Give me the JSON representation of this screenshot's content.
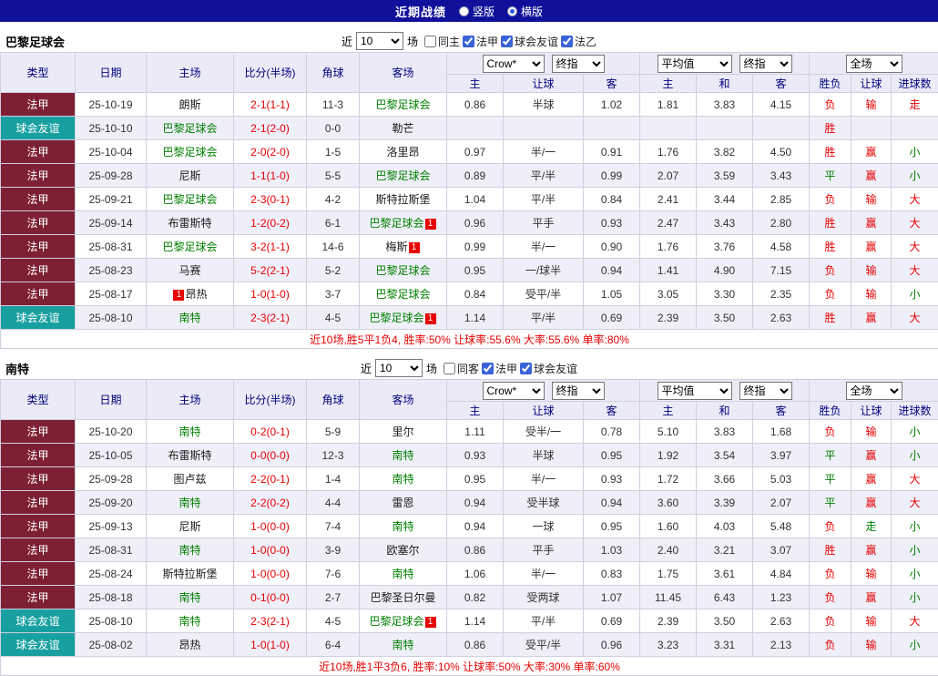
{
  "titlebar": {
    "title": "近期战绩",
    "radios": [
      {
        "label": "竖版",
        "selected": false
      },
      {
        "label": "横版",
        "selected": true
      }
    ]
  },
  "columns": {
    "type": "类型",
    "date": "日期",
    "home": "主场",
    "score": "比分(半场)",
    "corner": "角球",
    "away": "客场",
    "asian": [
      "主",
      "让球",
      "客"
    ],
    "euro": [
      "主",
      "和",
      "客"
    ],
    "result": [
      "胜负",
      "让球",
      "进球数"
    ]
  },
  "controls": {
    "near_label": "近",
    "near_value": "10",
    "games_label": "场",
    "selects": {
      "book": "Crow*",
      "final": "终指",
      "avg": "平均值",
      "final2": "终指",
      "scope": "全场"
    }
  },
  "colors": {
    "titlebar_bg": "#10109b",
    "league_bg": "#7e2033",
    "friendly_bg": "#18a0a0",
    "header_bg": "#ebebf8",
    "header_text": "#00007d",
    "highlight_team_green": "#008000",
    "accent_red": "#e60000",
    "alt_row_bg": "#efeff9"
  },
  "sections": [
    {
      "team": "巴黎足球会",
      "filters": [
        {
          "label": "同主",
          "checked": false
        },
        {
          "label": "法甲",
          "checked": true
        },
        {
          "label": "球会友谊",
          "checked": true
        },
        {
          "label": "法乙",
          "checked": true
        }
      ],
      "summary": "近10场,胜5平1负4, 胜率:50% 让球率:55.6% 大率:55.6% 单率:80%",
      "rows": [
        {
          "type": "法甲",
          "date": "25-10-19",
          "home": "朗斯",
          "home_hl": false,
          "score": "2-1(1-1)",
          "corner": "11-3",
          "away": "巴黎足球会",
          "away_hl": true,
          "asian": [
            "0.86",
            "半球",
            "1.02"
          ],
          "euro": [
            "1.81",
            "3.83",
            "4.15"
          ],
          "result": [
            "负",
            "输",
            "走"
          ],
          "result_colors": [
            "red",
            "red",
            "red"
          ]
        },
        {
          "type": "球会友谊",
          "friendly": true,
          "date": "25-10-10",
          "home": "巴黎足球会",
          "home_hl": true,
          "score": "2-1(2-0)",
          "corner": "0-0",
          "away": "勒芒",
          "away_hl": false,
          "asian": [
            "",
            "",
            ""
          ],
          "euro": [
            "",
            "",
            ""
          ],
          "result": [
            "胜",
            "",
            ""
          ],
          "result_colors": [
            "red",
            "",
            ""
          ]
        },
        {
          "type": "法甲",
          "date": "25-10-04",
          "home": "巴黎足球会",
          "home_hl": true,
          "score": "2-0(2-0)",
          "corner": "1-5",
          "away": "洛里昂",
          "away_hl": false,
          "asian": [
            "0.97",
            "半/一",
            "0.91"
          ],
          "euro": [
            "1.76",
            "3.82",
            "4.50"
          ],
          "result": [
            "胜",
            "赢",
            "小"
          ],
          "result_colors": [
            "red",
            "red",
            "green"
          ]
        },
        {
          "type": "法甲",
          "date": "25-09-28",
          "home": "尼斯",
          "home_hl": false,
          "score": "1-1(1-0)",
          "corner": "5-5",
          "away": "巴黎足球会",
          "away_hl": true,
          "asian": [
            "0.89",
            "平/半",
            "0.99"
          ],
          "euro": [
            "2.07",
            "3.59",
            "3.43"
          ],
          "result": [
            "平",
            "赢",
            "小"
          ],
          "result_colors": [
            "green",
            "red",
            "green"
          ]
        },
        {
          "type": "法甲",
          "date": "25-09-21",
          "home": "巴黎足球会",
          "home_hl": true,
          "score": "2-3(0-1)",
          "corner": "4-2",
          "away": "斯特拉斯堡",
          "away_hl": false,
          "asian": [
            "1.04",
            "平/半",
            "0.84"
          ],
          "euro": [
            "2.41",
            "3.44",
            "2.85"
          ],
          "result": [
            "负",
            "输",
            "大"
          ],
          "result_colors": [
            "red",
            "red",
            "red"
          ]
        },
        {
          "type": "法甲",
          "date": "25-09-14",
          "home": "布雷斯特",
          "home_hl": false,
          "score": "1-2(0-2)",
          "corner": "6-1",
          "away": "巴黎足球会",
          "away_hl": true,
          "away_badge": "1",
          "asian": [
            "0.96",
            "平手",
            "0.93"
          ],
          "euro": [
            "2.47",
            "3.43",
            "2.80"
          ],
          "result": [
            "胜",
            "赢",
            "大"
          ],
          "result_colors": [
            "red",
            "red",
            "red"
          ]
        },
        {
          "type": "法甲",
          "date": "25-08-31",
          "home": "巴黎足球会",
          "home_hl": true,
          "score": "3-2(1-1)",
          "corner": "14-6",
          "away": "梅斯",
          "away_hl": false,
          "away_badge": "1",
          "asian": [
            "0.99",
            "半/一",
            "0.90"
          ],
          "euro": [
            "1.76",
            "3.76",
            "4.58"
          ],
          "result": [
            "胜",
            "赢",
            "大"
          ],
          "result_colors": [
            "red",
            "red",
            "red"
          ]
        },
        {
          "type": "法甲",
          "date": "25-08-23",
          "home": "马赛",
          "home_hl": false,
          "score": "5-2(2-1)",
          "corner": "5-2",
          "away": "巴黎足球会",
          "away_hl": true,
          "asian": [
            "0.95",
            "一/球半",
            "0.94"
          ],
          "euro": [
            "1.41",
            "4.90",
            "7.15"
          ],
          "result": [
            "负",
            "输",
            "大"
          ],
          "result_colors": [
            "red",
            "red",
            "red"
          ]
        },
        {
          "type": "法甲",
          "date": "25-08-17",
          "home": "昂热",
          "home_hl": false,
          "home_badge": "1",
          "home_badge_before": true,
          "score": "1-0(1-0)",
          "corner": "3-7",
          "away": "巴黎足球会",
          "away_hl": true,
          "asian": [
            "0.84",
            "受平/半",
            "1.05"
          ],
          "euro": [
            "3.05",
            "3.30",
            "2.35"
          ],
          "result": [
            "负",
            "输",
            "小"
          ],
          "result_colors": [
            "red",
            "red",
            "green"
          ]
        },
        {
          "type": "球会友谊",
          "friendly": true,
          "date": "25-08-10",
          "home": "南特",
          "home_hl": true,
          "score": "2-3(2-1)",
          "corner": "4-5",
          "away": "巴黎足球会",
          "away_hl": true,
          "away_badge": "1",
          "asian": [
            "1.14",
            "平/半",
            "0.69"
          ],
          "euro": [
            "2.39",
            "3.50",
            "2.63"
          ],
          "result": [
            "胜",
            "赢",
            "大"
          ],
          "result_colors": [
            "red",
            "red",
            "red"
          ]
        }
      ]
    },
    {
      "team": "南特",
      "filters": [
        {
          "label": "同客",
          "checked": false
        },
        {
          "label": "法甲",
          "checked": true
        },
        {
          "label": "球会友谊",
          "checked": true
        }
      ],
      "summary": "近10场,胜1平3负6, 胜率:10% 让球率:50% 大率:30% 单率:60%",
      "rows": [
        {
          "type": "法甲",
          "date": "25-10-20",
          "home": "南特",
          "home_hl": true,
          "score": "0-2(0-1)",
          "corner": "5-9",
          "away": "里尔",
          "away_hl": false,
          "asian": [
            "1.11",
            "受半/一",
            "0.78"
          ],
          "euro": [
            "5.10",
            "3.83",
            "1.68"
          ],
          "result": [
            "负",
            "输",
            "小"
          ],
          "result_colors": [
            "red",
            "red",
            "green"
          ]
        },
        {
          "type": "法甲",
          "date": "25-10-05",
          "home": "布雷斯特",
          "home_hl": false,
          "score": "0-0(0-0)",
          "corner": "12-3",
          "away": "南特",
          "away_hl": true,
          "asian": [
            "0.93",
            "半球",
            "0.95"
          ],
          "euro": [
            "1.92",
            "3.54",
            "3.97"
          ],
          "result": [
            "平",
            "赢",
            "小"
          ],
          "result_colors": [
            "green",
            "red",
            "green"
          ]
        },
        {
          "type": "法甲",
          "date": "25-09-28",
          "home": "图卢兹",
          "home_hl": false,
          "score": "2-2(0-1)",
          "corner": "1-4",
          "away": "南特",
          "away_hl": true,
          "asian": [
            "0.95",
            "半/一",
            "0.93"
          ],
          "euro": [
            "1.72",
            "3.66",
            "5.03"
          ],
          "result": [
            "平",
            "赢",
            "大"
          ],
          "result_colors": [
            "green",
            "red",
            "red"
          ]
        },
        {
          "type": "法甲",
          "date": "25-09-20",
          "home": "南特",
          "home_hl": true,
          "score": "2-2(0-2)",
          "corner": "4-4",
          "away": "雷恩",
          "away_hl": false,
          "asian": [
            "0.94",
            "受半球",
            "0.94"
          ],
          "euro": [
            "3.60",
            "3.39",
            "2.07"
          ],
          "result": [
            "平",
            "赢",
            "大"
          ],
          "result_colors": [
            "green",
            "red",
            "red"
          ]
        },
        {
          "type": "法甲",
          "date": "25-09-13",
          "home": "尼斯",
          "home_hl": false,
          "score": "1-0(0-0)",
          "corner": "7-4",
          "away": "南特",
          "away_hl": true,
          "asian": [
            "0.94",
            "一球",
            "0.95"
          ],
          "euro": [
            "1.60",
            "4.03",
            "5.48"
          ],
          "result": [
            "负",
            "走",
            "小"
          ],
          "result_colors": [
            "red",
            "green",
            "green"
          ]
        },
        {
          "type": "法甲",
          "date": "25-08-31",
          "home": "南特",
          "home_hl": true,
          "score": "1-0(0-0)",
          "corner": "3-9",
          "away": "欧塞尔",
          "away_hl": false,
          "asian": [
            "0.86",
            "平手",
            "1.03"
          ],
          "euro": [
            "2.40",
            "3.21",
            "3.07"
          ],
          "result": [
            "胜",
            "赢",
            "小"
          ],
          "result_colors": [
            "red",
            "red",
            "green"
          ]
        },
        {
          "type": "法甲",
          "date": "25-08-24",
          "home": "斯特拉斯堡",
          "home_hl": false,
          "score": "1-0(0-0)",
          "corner": "7-6",
          "away": "南特",
          "away_hl": true,
          "asian": [
            "1.06",
            "半/一",
            "0.83"
          ],
          "euro": [
            "1.75",
            "3.61",
            "4.84"
          ],
          "result": [
            "负",
            "输",
            "小"
          ],
          "result_colors": [
            "red",
            "red",
            "green"
          ]
        },
        {
          "type": "法甲",
          "date": "25-08-18",
          "home": "南特",
          "home_hl": true,
          "score": "0-1(0-0)",
          "corner": "2-7",
          "away": "巴黎圣日尔曼",
          "away_hl": false,
          "asian": [
            "0.82",
            "受两球",
            "1.07"
          ],
          "euro": [
            "11.45",
            "6.43",
            "1.23"
          ],
          "result": [
            "负",
            "赢",
            "小"
          ],
          "result_colors": [
            "red",
            "red",
            "green"
          ]
        },
        {
          "type": "球会友谊",
          "friendly": true,
          "date": "25-08-10",
          "home": "南特",
          "home_hl": true,
          "score": "2-3(2-1)",
          "corner": "4-5",
          "away": "巴黎足球会",
          "away_hl": true,
          "away_badge": "1",
          "asian": [
            "1.14",
            "平/半",
            "0.69"
          ],
          "euro": [
            "2.39",
            "3.50",
            "2.63"
          ],
          "result": [
            "负",
            "输",
            "大"
          ],
          "result_colors": [
            "red",
            "red",
            "red"
          ]
        },
        {
          "type": "球会友谊",
          "friendly": true,
          "date": "25-08-02",
          "home": "昂热",
          "home_hl": false,
          "score": "1-0(1-0)",
          "corner": "6-4",
          "away": "南特",
          "away_hl": true,
          "asian": [
            "0.86",
            "受平/半",
            "0.96"
          ],
          "euro": [
            "3.23",
            "3.31",
            "2.13"
          ],
          "result": [
            "负",
            "输",
            "小"
          ],
          "result_colors": [
            "red",
            "red",
            "green"
          ]
        }
      ]
    }
  ]
}
